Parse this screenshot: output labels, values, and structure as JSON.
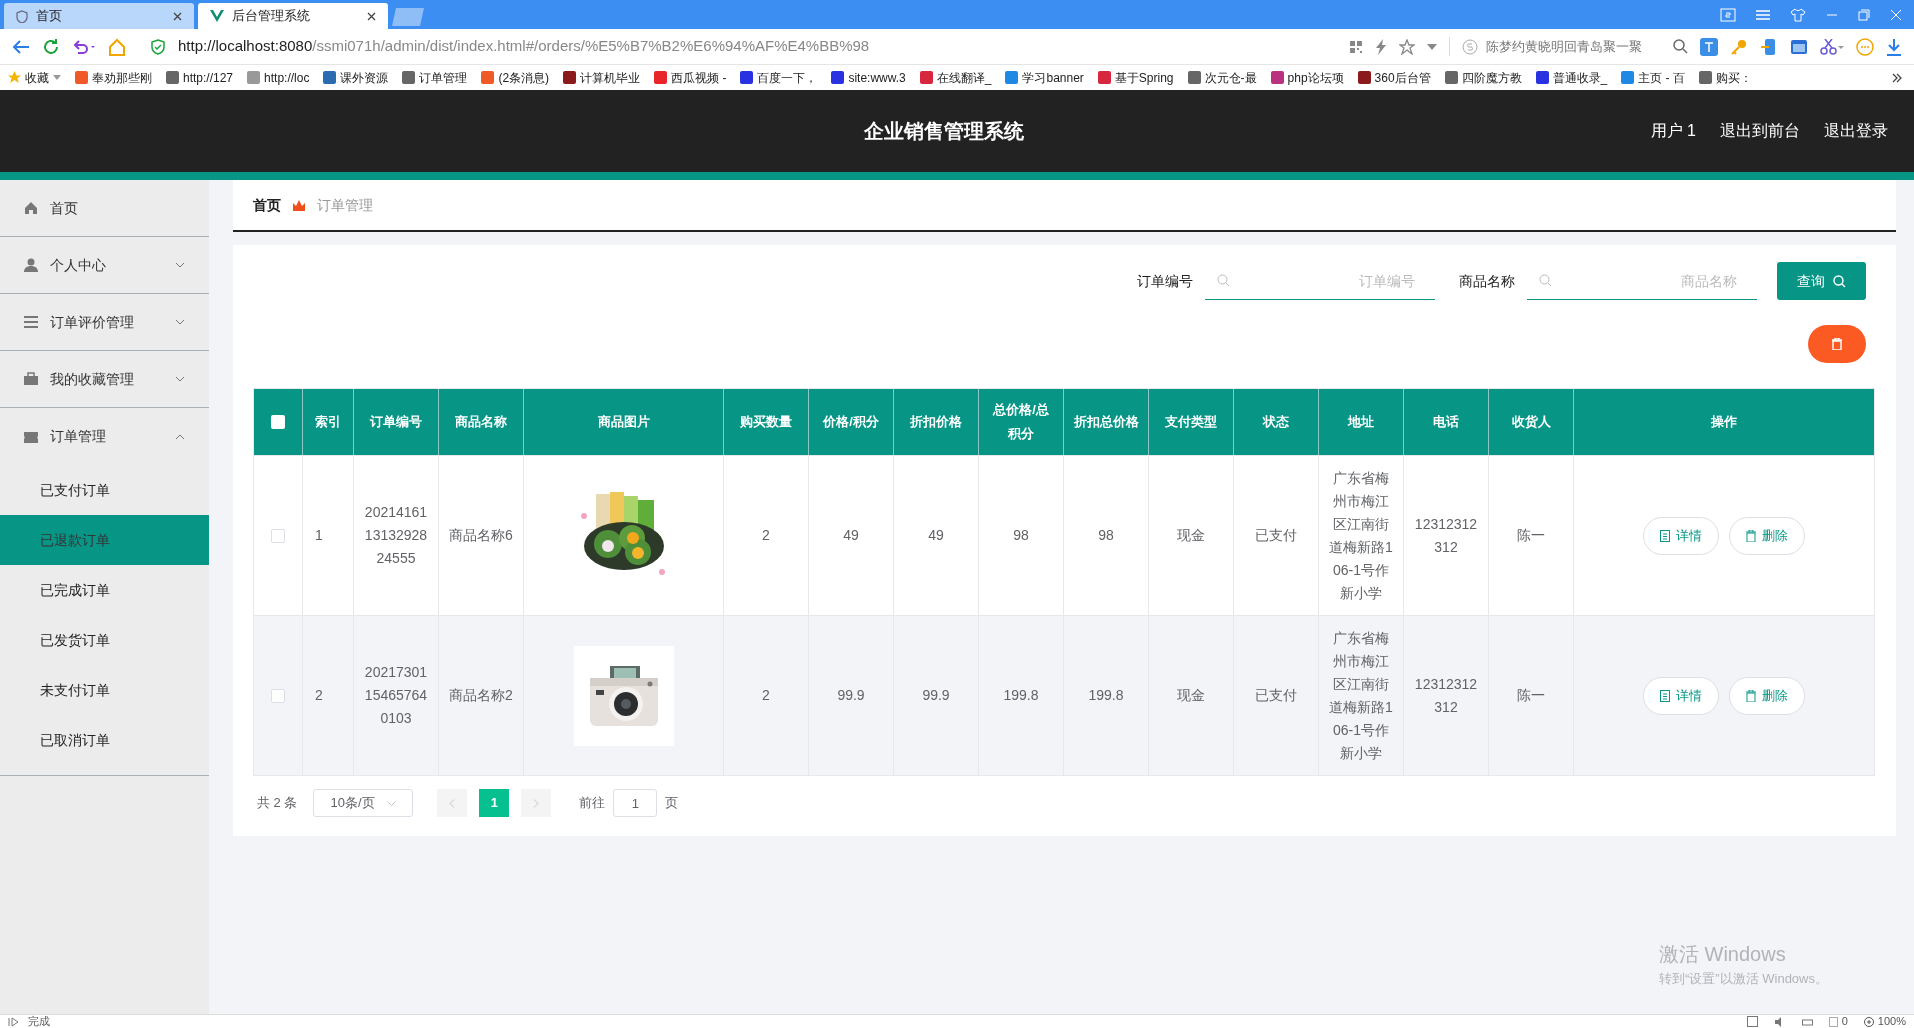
{
  "browser": {
    "tabs": [
      {
        "label": "首页",
        "selected": false
      },
      {
        "label": "后台管理系统",
        "selected": true
      }
    ],
    "url_host": "http://localhost:8080",
    "url_path": "/ssmi071h/admin/dist/index.html#/orders/%E5%B7%B2%E6%94%AF%E4%BB%98",
    "search_text": "陈梦约黄晓明回青岛聚一聚",
    "bookmarks": [
      {
        "label": "收藏",
        "color": "#f5b400"
      },
      {
        "label": "奉劝那些刚",
        "color": "#f05a28"
      },
      {
        "label": "http://127",
        "color": "#666666"
      },
      {
        "label": "http://loc",
        "color": "#999999"
      },
      {
        "label": "课外资源",
        "color": "#2b6cb0"
      },
      {
        "label": "订单管理",
        "color": "#666666"
      },
      {
        "label": "(2条消息)",
        "color": "#f05a28"
      },
      {
        "label": "计算机毕业",
        "color": "#8b1a1a"
      },
      {
        "label": "西瓜视频 -",
        "color": "#e8262a"
      },
      {
        "label": "百度一下，",
        "color": "#2932e1"
      },
      {
        "label": "site:www.3",
        "color": "#2932e1"
      },
      {
        "label": "在线翻译_",
        "color": "#d7263d"
      },
      {
        "label": "学习banner",
        "color": "#1e88e5"
      },
      {
        "label": "基于Spring",
        "color": "#d7263d"
      },
      {
        "label": "次元仓-最",
        "color": "#666666"
      },
      {
        "label": "php论坛项",
        "color": "#b83280"
      },
      {
        "label": "360后台管",
        "color": "#8b1a1a"
      },
      {
        "label": "四阶魔方教",
        "color": "#666666"
      },
      {
        "label": "普通收录_",
        "color": "#2932e1"
      },
      {
        "label": "主页 - 百",
        "color": "#1e88e5"
      },
      {
        "label": "购买：",
        "color": "#666666"
      }
    ]
  },
  "header": {
    "title": "企业销售管理系统",
    "links": [
      "用户 1",
      "退出到前台",
      "退出登录"
    ]
  },
  "sidebar": {
    "items": [
      {
        "label": "首页",
        "kind": "home"
      },
      {
        "label": "个人中心",
        "kind": "user",
        "expanded": false
      },
      {
        "label": "订单评价管理",
        "kind": "list",
        "expanded": false
      },
      {
        "label": "我的收藏管理",
        "kind": "case",
        "expanded": false
      },
      {
        "label": "订单管理",
        "kind": "ticket",
        "expanded": true,
        "children": [
          {
            "label": "已支付订单",
            "selected": false
          },
          {
            "label": "已退款订单",
            "selected": true
          },
          {
            "label": "已完成订单",
            "selected": false
          },
          {
            "label": "已发货订单",
            "selected": false
          },
          {
            "label": "未支付订单",
            "selected": false
          },
          {
            "label": "已取消订单",
            "selected": false
          }
        ]
      }
    ]
  },
  "breadcrumb": [
    "首页",
    "订单管理"
  ],
  "search": {
    "fields": [
      {
        "label": "订单编号",
        "placeholder": "订单编号"
      },
      {
        "label": "商品名称",
        "placeholder": "商品名称"
      }
    ],
    "button": "查询"
  },
  "table": {
    "all_checked": false,
    "columns": [
      "索引",
      "订单编号",
      "商品名称",
      "商品图片",
      "购买数量",
      "价格/积分",
      "折扣价格",
      "总价格/总积分",
      "折扣总价格",
      "支付类型",
      "状态",
      "地址",
      "电话",
      "收货人",
      "操作"
    ],
    "rows": [
      {
        "checked": false,
        "cells": [
          "1",
          "2021416113132928 24555",
          "商品名称6",
          {
            "kind": "picture"
          },
          "2",
          "49",
          "49",
          "98",
          "98",
          "现金",
          "已支付",
          "广东省梅州市梅江区江南街道梅新路106-1号作新小学",
          "12312312312",
          "陈一"
        ],
        "actions": [
          "详情",
          "删除"
        ]
      },
      {
        "checked": false,
        "cells": [
          "2",
          "20217301154657640103",
          "商品名称2",
          {
            "kind": "picture"
          },
          "2",
          "99.9",
          "99.9",
          "199.8",
          "199.8",
          "现金",
          "已支付",
          "广东省梅州市梅江区江南街道梅新路106-1号作新小学",
          "12312312312",
          "陈一"
        ],
        "actions": [
          "详情",
          "删除"
        ]
      }
    ]
  },
  "pagination": {
    "total": "共 2 条",
    "page_size": "10条/页",
    "pages": [
      {
        "label": "1",
        "selected": true
      }
    ],
    "goto_label": "前往",
    "goto_value": "1",
    "goto_suffix": "页"
  },
  "os_notice": {
    "title": "激活 Windows",
    "text": "转到“设置”以激活 Windows。"
  },
  "status_bar": {
    "text": "完成",
    "count": "0",
    "zoom": "100%"
  }
}
